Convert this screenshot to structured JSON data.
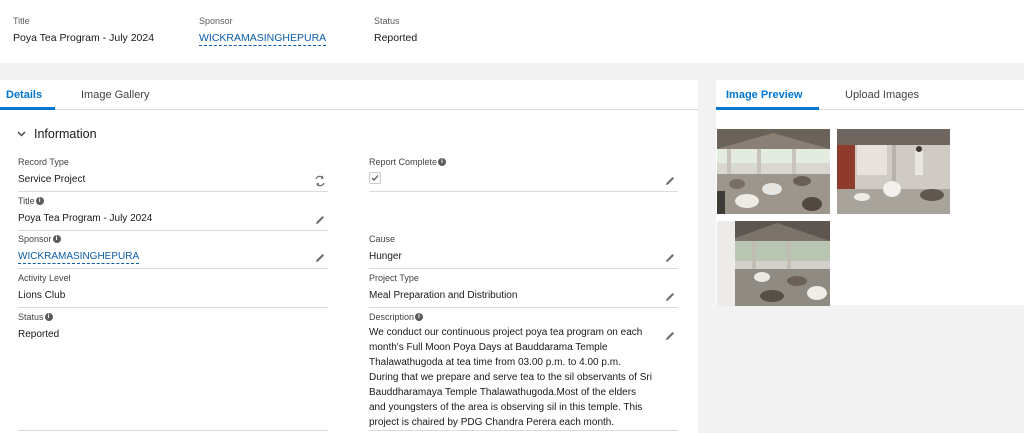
{
  "header": {
    "title_label": "Title",
    "title_value": "Poya Tea Program - July 2024",
    "sponsor_label": "Sponsor",
    "sponsor_value": "WICKRAMASINGHEPURA",
    "status_label": "Status",
    "status_value": "Reported"
  },
  "left_tabs": [
    "Details",
    "Image Gallery"
  ],
  "section": {
    "title": "Information"
  },
  "fields": {
    "record_type": {
      "label": "Record Type",
      "value": "Service Project"
    },
    "title": {
      "label": "Title",
      "value": "Poya Tea Program - July 2024"
    },
    "sponsor": {
      "label": "Sponsor",
      "value": "WICKRAMASINGHEPURA"
    },
    "activity_level": {
      "label": "Activity Level",
      "value": "Lions Club"
    },
    "status": {
      "label": "Status",
      "value": "Reported"
    },
    "report_complete": {
      "label": "Report Complete",
      "checked": true
    },
    "cause": {
      "label": "Cause",
      "value": "Hunger"
    },
    "project_type": {
      "label": "Project Type",
      "value": "Meal Preparation and Distribution"
    },
    "description": {
      "label": "Description",
      "lines": [
        "We conduct our continuous project poya tea program on each",
        "month's Full Moon Poya Days at Bauddarama Temple",
        "Thalawathugoda at tea time from 03.00 p.m. to 4.00 p.m.",
        "During that we prepare and serve tea to the sil observants of Sri",
        "Bauddharamaya Temple Thalawathugoda.Most of the elders",
        "and youngsters of the area is observing sil in this temple. This",
        "project is chaired by PDG Chandra Perera each month."
      ]
    }
  },
  "right_tabs": [
    "Image Preview",
    "Upload Images"
  ],
  "colors": {
    "accent": "#0176d3",
    "link": "#0b5cab",
    "border": "#dddbda",
    "background": "#f3f2f2"
  },
  "icons": [
    "chevron-down-icon",
    "info-icon",
    "pencil-icon",
    "change-record-type-icon",
    "checkmark-icon"
  ]
}
